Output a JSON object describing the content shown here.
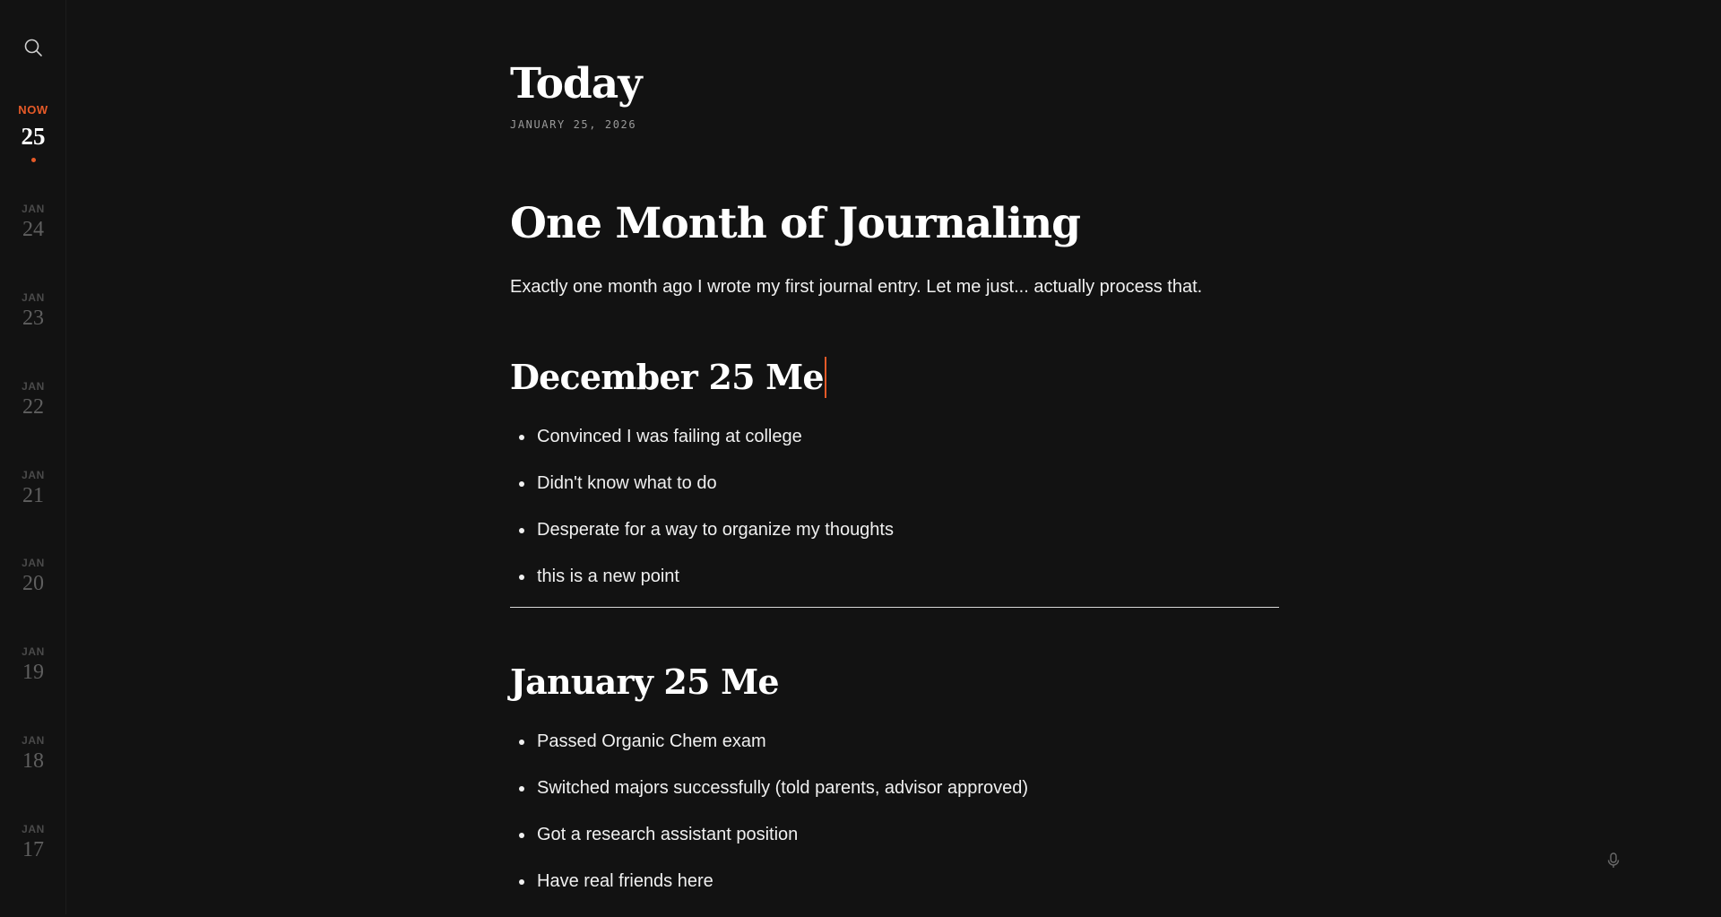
{
  "sidebar": {
    "current": {
      "label": "NOW",
      "day": "25"
    },
    "days": [
      {
        "month": "JAN",
        "day": "24"
      },
      {
        "month": "JAN",
        "day": "23"
      },
      {
        "month": "JAN",
        "day": "22"
      },
      {
        "month": "JAN",
        "day": "21"
      },
      {
        "month": "JAN",
        "day": "20"
      },
      {
        "month": "JAN",
        "day": "19"
      },
      {
        "month": "JAN",
        "day": "18"
      },
      {
        "month": "JAN",
        "day": "17"
      }
    ]
  },
  "page": {
    "title": "Today",
    "date": "JANUARY 25, 2026"
  },
  "entry": {
    "title": "One Month of Journaling",
    "intro": "Exactly one month ago I wrote my first journal entry. Let me just... actually process that.",
    "sections": [
      {
        "heading": "December 25 Me",
        "items": [
          "Convinced I was failing at college",
          "Didn't know what to do",
          "Desperate for a way to organize my thoughts",
          "this is a new point"
        ]
      },
      {
        "heading": "January 25 Me",
        "items": [
          "Passed Organic Chem exam",
          "Switched majors successfully (told parents, advisor approved)",
          "Got a research assistant position",
          "Have real friends here"
        ]
      }
    ]
  },
  "icons": {
    "search": "search-icon",
    "mic": "microphone-icon"
  },
  "colors": {
    "background": "#121212",
    "accent": "#e65a28",
    "text": "#f0f0f0",
    "muted_day": "#5f5f5f"
  }
}
